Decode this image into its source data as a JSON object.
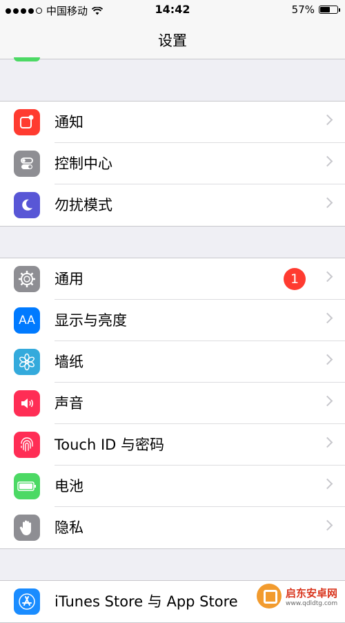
{
  "status_bar": {
    "carrier": "中国移动",
    "time": "14:42",
    "battery_percent": "57%",
    "battery_level": 0.57
  },
  "nav": {
    "title": "设置"
  },
  "groups": [
    {
      "rows": [
        {
          "label": "通知",
          "icon": "notifications-icon",
          "color": "#ff3b30"
        },
        {
          "label": "控制中心",
          "icon": "control-center-icon",
          "color": "#8e8e93"
        },
        {
          "label": "勿扰模式",
          "icon": "moon-icon",
          "color": "#5856d6"
        }
      ]
    },
    {
      "rows": [
        {
          "label": "通用",
          "icon": "gear-icon",
          "color": "#8e8e93",
          "badge": "1"
        },
        {
          "label": "显示与亮度",
          "icon": "display-icon",
          "color": "#007aff",
          "icon_text": "AA"
        },
        {
          "label": "墙纸",
          "icon": "flower-icon",
          "color": "#34aadc"
        },
        {
          "label": "声音",
          "icon": "speaker-icon",
          "color": "#ff2d55"
        },
        {
          "label": "Touch ID 与密码",
          "icon": "fingerprint-icon",
          "color": "#ff2d55"
        },
        {
          "label": "电池",
          "icon": "battery-icon",
          "color": "#4cd964"
        },
        {
          "label": "隐私",
          "icon": "hand-icon",
          "color": "#8e8e93"
        }
      ]
    },
    {
      "rows": [
        {
          "label": "iTunes Store 与 App Store",
          "icon": "app-store-icon",
          "color": "#1a8cff"
        }
      ]
    }
  ],
  "watermark": {
    "title": "启东安卓网",
    "url": "www.qdldtg.com"
  }
}
